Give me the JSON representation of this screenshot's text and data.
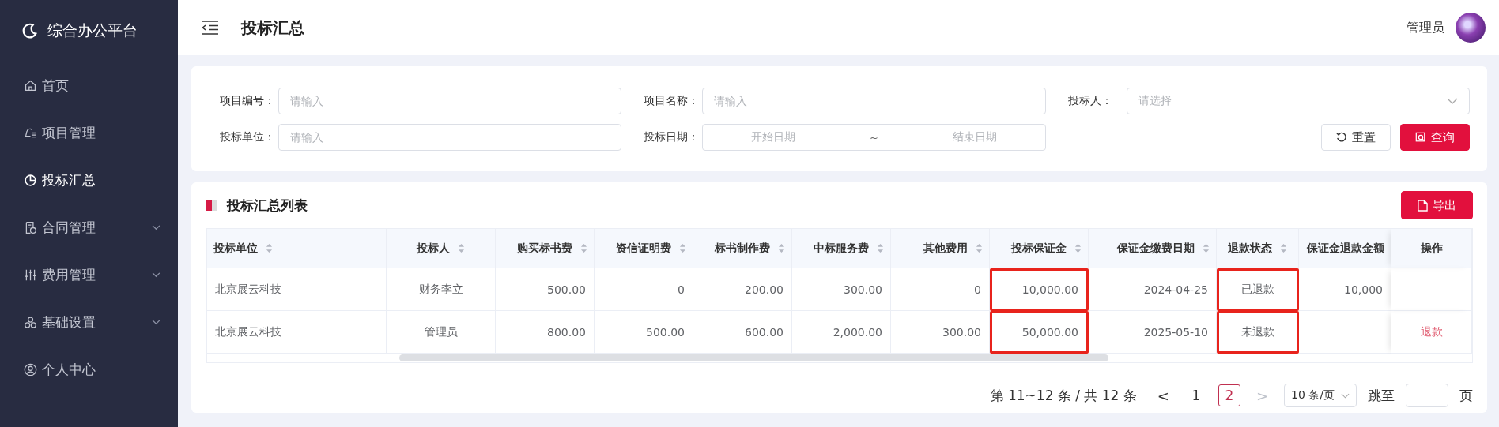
{
  "sidebar": {
    "logo": "综合办公平台",
    "items": [
      {
        "label": "首页",
        "selected": false,
        "expandable": false
      },
      {
        "label": "项目管理",
        "selected": false,
        "expandable": false
      },
      {
        "label": "投标汇总",
        "selected": true,
        "expandable": false
      },
      {
        "label": "合同管理",
        "selected": false,
        "expandable": true
      },
      {
        "label": "费用管理",
        "selected": false,
        "expandable": true
      },
      {
        "label": "基础设置",
        "selected": false,
        "expandable": true
      },
      {
        "label": "个人中心",
        "selected": false,
        "expandable": false
      }
    ]
  },
  "header": {
    "title": "投标汇总",
    "user": "管理员"
  },
  "filters": [
    {
      "label": "项目编号：",
      "kind": "text",
      "placeholder": "请输入"
    },
    {
      "label": "项目名称：",
      "kind": "text",
      "placeholder": "请输入"
    },
    {
      "label": "投标人：",
      "kind": "select",
      "placeholder": "请选择"
    },
    {
      "label": "投标单位：",
      "kind": "text",
      "placeholder": "请输入"
    },
    {
      "label": "投标日期：",
      "kind": "daterange",
      "start_placeholder": "开始日期",
      "separator": "~",
      "end_placeholder": "结束日期"
    }
  ],
  "filter_buttons": [
    {
      "label": "重置",
      "kind": "reset"
    },
    {
      "label": "查询",
      "kind": "search"
    }
  ],
  "table_card": {
    "title": "投标汇总列表",
    "export_button": "导出",
    "columns": [
      {
        "label": "投标单位",
        "sortable": true
      },
      {
        "label": "投标人",
        "sortable": true
      },
      {
        "label": "购买标书费",
        "sortable": true
      },
      {
        "label": "资信证明费",
        "sortable": true
      },
      {
        "label": "标书制作费",
        "sortable": true
      },
      {
        "label": "中标服务费",
        "sortable": true
      },
      {
        "label": "其他费用",
        "sortable": true
      },
      {
        "label": "投标保证金",
        "sortable": true
      },
      {
        "label": "保证金缴费日期",
        "sortable": true
      },
      {
        "label": "退款状态",
        "sortable": true
      },
      {
        "label": "保证金退款金额",
        "sortable": false
      },
      {
        "label": "操作",
        "sortable": false
      }
    ],
    "rows": [
      {
        "cells": [
          {
            "text": "北京展云科技",
            "highlighted": false
          },
          {
            "text": "财务李立",
            "highlighted": false
          },
          {
            "text": "500.00",
            "highlighted": false
          },
          {
            "text": "0",
            "highlighted": false
          },
          {
            "text": "200.00",
            "highlighted": false
          },
          {
            "text": "300.00",
            "highlighted": false
          },
          {
            "text": "0",
            "highlighted": false
          },
          {
            "text": "10,000.00",
            "highlighted": true
          },
          {
            "text": "2024-04-25",
            "highlighted": false
          },
          {
            "text": "已退款",
            "highlighted": true
          },
          {
            "text": "10,000",
            "highlighted": false
          },
          {
            "highlighted": false
          }
        ]
      },
      {
        "cells": [
          {
            "text": "北京展云科技",
            "highlighted": false
          },
          {
            "text": "管理员",
            "highlighted": false
          },
          {
            "text": "800.00",
            "highlighted": false
          },
          {
            "text": "500.00",
            "highlighted": false
          },
          {
            "text": "600.00",
            "highlighted": false
          },
          {
            "text": "2,000.00",
            "highlighted": false
          },
          {
            "text": "300.00",
            "highlighted": false
          },
          {
            "text": "50,000.00",
            "highlighted": true
          },
          {
            "text": "2025-05-10",
            "highlighted": false
          },
          {
            "text": "未退款",
            "highlighted": true
          },
          {
            "highlighted": false
          },
          {
            "text": "退款",
            "highlighted": false,
            "kind": "link"
          }
        ]
      }
    ],
    "pagination": {
      "summary": "第 11~12 条 / 共 12 条",
      "prev": "<",
      "next": ">",
      "next_disabled": true,
      "pages": [
        {
          "label": "1",
          "selected": false
        },
        {
          "label": "2",
          "selected": true
        }
      ],
      "page_size": "10 条/页",
      "jump_label": "跳至",
      "jump_suffix": "页"
    }
  }
}
